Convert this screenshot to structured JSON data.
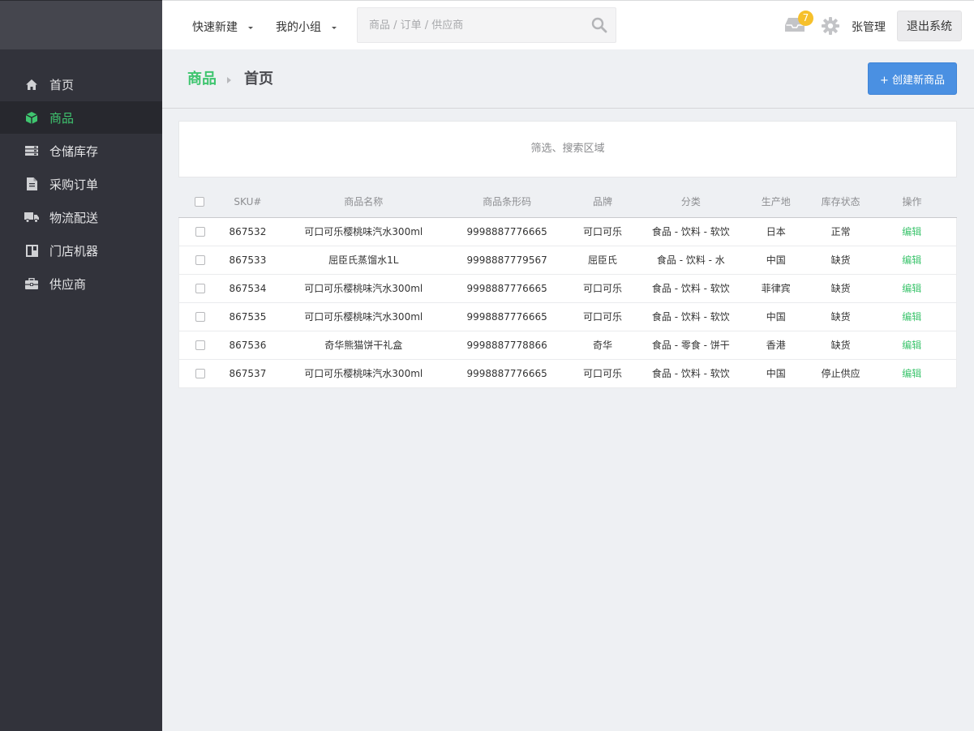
{
  "nav": {
    "items": [
      {
        "label": "首页",
        "icon": "home-icon"
      },
      {
        "label": "商品",
        "icon": "box-icon"
      },
      {
        "label": "仓储库存",
        "icon": "warehouse-icon"
      },
      {
        "label": "采购订单",
        "icon": "document-icon"
      },
      {
        "label": "物流配送",
        "icon": "truck-icon"
      },
      {
        "label": "门店机器",
        "icon": "store-icon"
      },
      {
        "label": "供应商",
        "icon": "briefcase-icon"
      }
    ],
    "active_index": 1
  },
  "topbar": {
    "quick_new": "快速新建",
    "my_group": "我的小组",
    "search_placeholder": "商品 / 订单 / 供应商",
    "notification_count": "7",
    "username": "张管理",
    "logout": "退出系统"
  },
  "header": {
    "crumb_section": "商品",
    "crumb_page": "首页",
    "create_button": "+ 创建新商品"
  },
  "filter_area": {
    "label": "筛选、搜索区域"
  },
  "table": {
    "columns": [
      "SKU#",
      "商品名称",
      "商品条形码",
      "品牌",
      "分类",
      "生产地",
      "库存状态",
      "操作"
    ],
    "rows": [
      {
        "sku": "867532",
        "name": "可口可乐樱桃味汽水300ml",
        "barcode": "9998887776665",
        "brand": "可口可乐",
        "category": "食品 - 饮料 - 软饮",
        "origin": "日本",
        "stock": "正常",
        "stock_status": "normal",
        "action": "编辑"
      },
      {
        "sku": "867533",
        "name": "屈臣氏蒸馏水1L",
        "barcode": "9998887779567",
        "brand": "屈臣氏",
        "category": "食品 - 饮料 - 水",
        "origin": "中国",
        "stock": "缺货",
        "stock_status": "out",
        "action": "编辑"
      },
      {
        "sku": "867534",
        "name": "可口可乐樱桃味汽水300ml",
        "barcode": "9998887776665",
        "brand": "可口可乐",
        "category": "食品 - 饮料 - 软饮",
        "origin": "菲律宾",
        "stock": "缺货",
        "stock_status": "out",
        "action": "编辑"
      },
      {
        "sku": "867535",
        "name": "可口可乐樱桃味汽水300ml",
        "barcode": "9998887776665",
        "brand": "可口可乐",
        "category": "食品 - 饮料 - 软饮",
        "origin": "中国",
        "stock": "缺货",
        "stock_status": "out",
        "action": "编辑"
      },
      {
        "sku": "867536",
        "name": "奇华熊猫饼干礼盒",
        "barcode": "9998887778866",
        "brand": "奇华",
        "category": "食品 - 零食 - 饼干",
        "origin": "香港",
        "stock": "缺货",
        "stock_status": "out",
        "action": "编辑"
      },
      {
        "sku": "867537",
        "name": "可口可乐樱桃味汽水300ml",
        "barcode": "9998887776665",
        "brand": "可口可乐",
        "category": "食品 - 饮料 - 软饮",
        "origin": "中国",
        "stock": "停止供应",
        "stock_status": "stopped",
        "action": "编辑"
      }
    ]
  },
  "colors": {
    "accent_green": "#3fc56f",
    "alert_red": "#e24c4c",
    "primary_blue": "#4a90e2",
    "badge_yellow": "#f6c02b",
    "sidebar_bg": "#32333b"
  }
}
